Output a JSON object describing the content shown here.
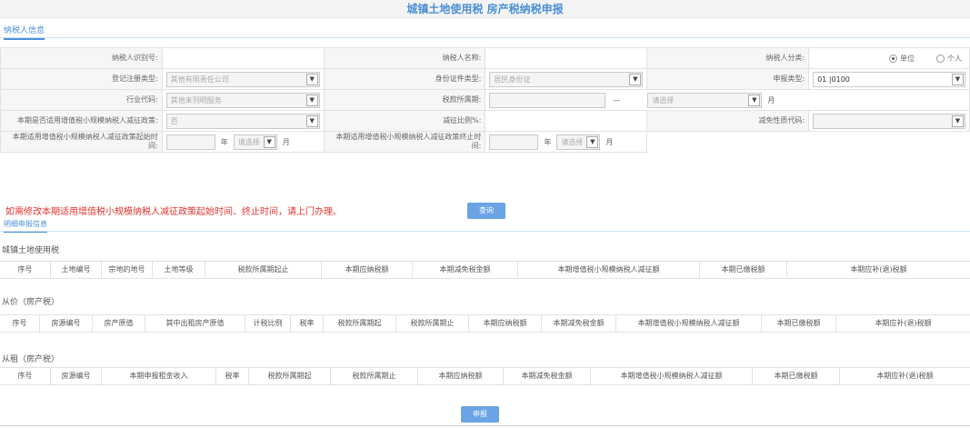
{
  "header": {
    "title": "城镇土地使用税 房产税纳税申报"
  },
  "tabs": {
    "taxpayer_info": "纳税人信息",
    "detail": "明细申报信息"
  },
  "form": {
    "taxpayer_id_label": "纳税人识别号:",
    "taxpayer_name_label": "纳税人名称:",
    "taxpayer_type_label": "纳税人分类:",
    "taxpayer_type_options": [
      "单位",
      "个人"
    ],
    "reg_type_label": "登记注册类型:",
    "reg_type_value": "其他有限责任公司",
    "id_type_label": "身份证件类型:",
    "id_type_value": "居民身份证",
    "report_type_label": "申报类型:",
    "report_type_value": "01 |0100",
    "industry_label": "行业代码:",
    "industry_value": "其他未列明服务",
    "period_label": "税款所属期:",
    "period_sep": "—",
    "period_unit": "月",
    "period_select_placeholder": "请选择",
    "small_scale_label": "本期是否适用增值税小规模纳税人减征政策:",
    "small_scale_value": "否",
    "reduction_ratio_label": "减征比例%:",
    "reduction_nature_label": "减免性质代码:",
    "start_time_label": "本期适用增值税小规模纳税人减征政策起始时间:",
    "end_time_label": "本期适用增值税小规模纳税人减征政策终止时间:",
    "year_unit": "年",
    "month_placeholder": "请选择",
    "month_unit": "月"
  },
  "warning": "如需修改本期适用增值税小规模纳税人减征政策起始时间、终止时间，请上门办理。",
  "buttons": {
    "query": "查询",
    "submit": "申报"
  },
  "sections": {
    "land": {
      "title": "城镇土地使用税",
      "headers": [
        "序号",
        "土地编号",
        "宗地的地号",
        "土地等级",
        "税款所属期起止",
        "本期应纳税额",
        "本期减免税金额",
        "本期增值税小规模纳税人减征额",
        "本期已缴税额",
        "本期应补(退)税额"
      ]
    },
    "price": {
      "title": "从价（房产税）",
      "headers": [
        "序号",
        "房源编号",
        "房产原值",
        "其中出租房产原值",
        "计税比例",
        "税率",
        "税款所属期起",
        "税款所属期止",
        "本期应纳税额",
        "本期减免税金额",
        "本期增值税小规模纳税人减征额",
        "本期已缴税额",
        "本期应补(退)税额"
      ]
    },
    "rent": {
      "title": "从租（房产税）",
      "headers": [
        "序号",
        "房源编号",
        "本期申报租金收入",
        "税率",
        "税款所属期起",
        "税款所属期止",
        "本期应纳税额",
        "本期减免税金额",
        "本期增值税小规模纳税人减征额",
        "本期已缴税额",
        "本期应补(退)税额"
      ]
    }
  }
}
